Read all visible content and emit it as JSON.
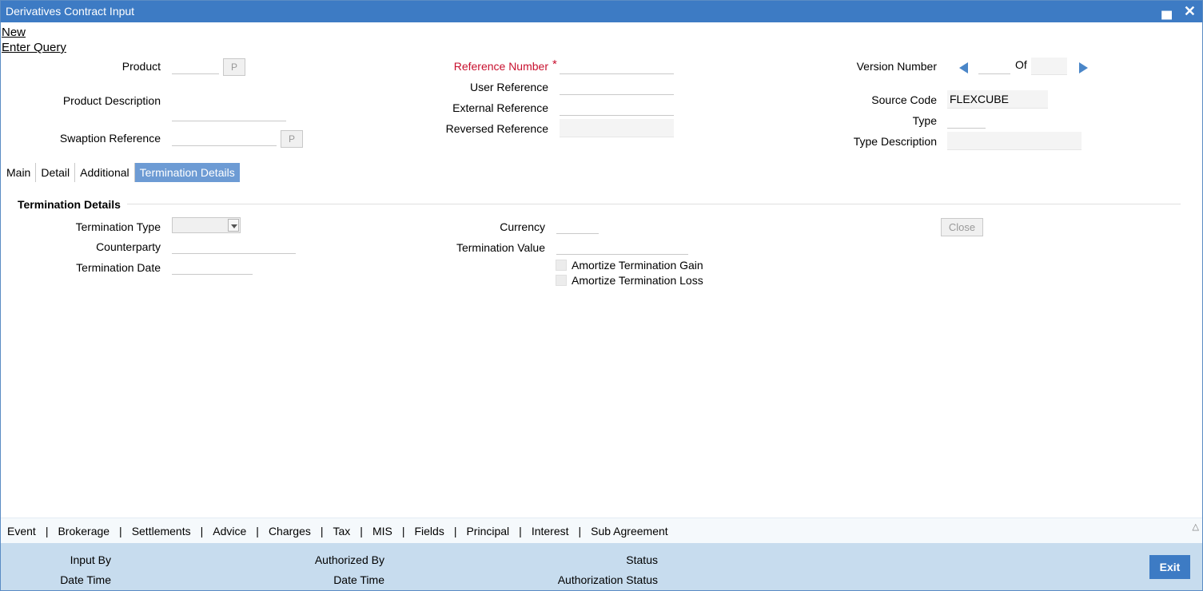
{
  "window": {
    "title": "Derivatives Contract Input"
  },
  "menu": {
    "new": "New",
    "enter_query": "Enter Query"
  },
  "header": {
    "product_label": "Product",
    "product_value": "",
    "p_button": "P",
    "product_description_label": "Product Description",
    "product_description_value": "",
    "swaption_reference_label": "Swaption Reference",
    "swaption_reference_value": "",
    "reference_number_label": "Reference Number",
    "required_marker": "*",
    "reference_number_value": "",
    "user_reference_label": "User Reference",
    "user_reference_value": "",
    "external_reference_label": "External Reference",
    "external_reference_value": "",
    "reversed_reference_label": "Reversed Reference",
    "reversed_reference_value": "",
    "version_number_label": "Version Number",
    "version_value": "",
    "of_label": "Of",
    "version_total": "",
    "source_code_label": "Source Code",
    "source_code_value": "FLEXCUBE",
    "type_label": "Type",
    "type_value": "",
    "type_description_label": "Type Description",
    "type_description_value": ""
  },
  "tabs": [
    {
      "label": "Main"
    },
    {
      "label": "Detail"
    },
    {
      "label": "Additional"
    },
    {
      "label": "Termination Details"
    }
  ],
  "termination": {
    "section_title": "Termination Details",
    "termination_type_label": "Termination Type",
    "termination_type_value": "",
    "counterparty_label": "Counterparty",
    "counterparty_value": "",
    "termination_date_label": "Termination Date",
    "termination_date_value": "",
    "currency_label": "Currency",
    "currency_value": "",
    "termination_value_label": "Termination Value",
    "termination_value_value": "",
    "amortize_gain_label": "Amortize Termination Gain",
    "amortize_loss_label": "Amortize Termination Loss",
    "close_button": "Close"
  },
  "bottom_nav": {
    "links": [
      "Event",
      "Brokerage",
      "Settlements",
      "Advice",
      "Charges",
      "Tax",
      "MIS",
      "Fields",
      "Principal",
      "Interest",
      "Sub Agreement"
    ],
    "separator": "|"
  },
  "footer": {
    "input_by_label": "Input By",
    "date_time_label_1": "Date Time",
    "authorized_by_label": "Authorized By",
    "date_time_label_2": "Date Time",
    "status_label": "Status",
    "authorization_status_label": "Authorization Status",
    "exit_button": "Exit"
  },
  "colors": {
    "titlebar": "#3d7bc4",
    "active_tab": "#6d9bd4",
    "required_label": "#c8102e",
    "footer_bg": "#c7dcee",
    "arrow": "#4a86c8"
  }
}
